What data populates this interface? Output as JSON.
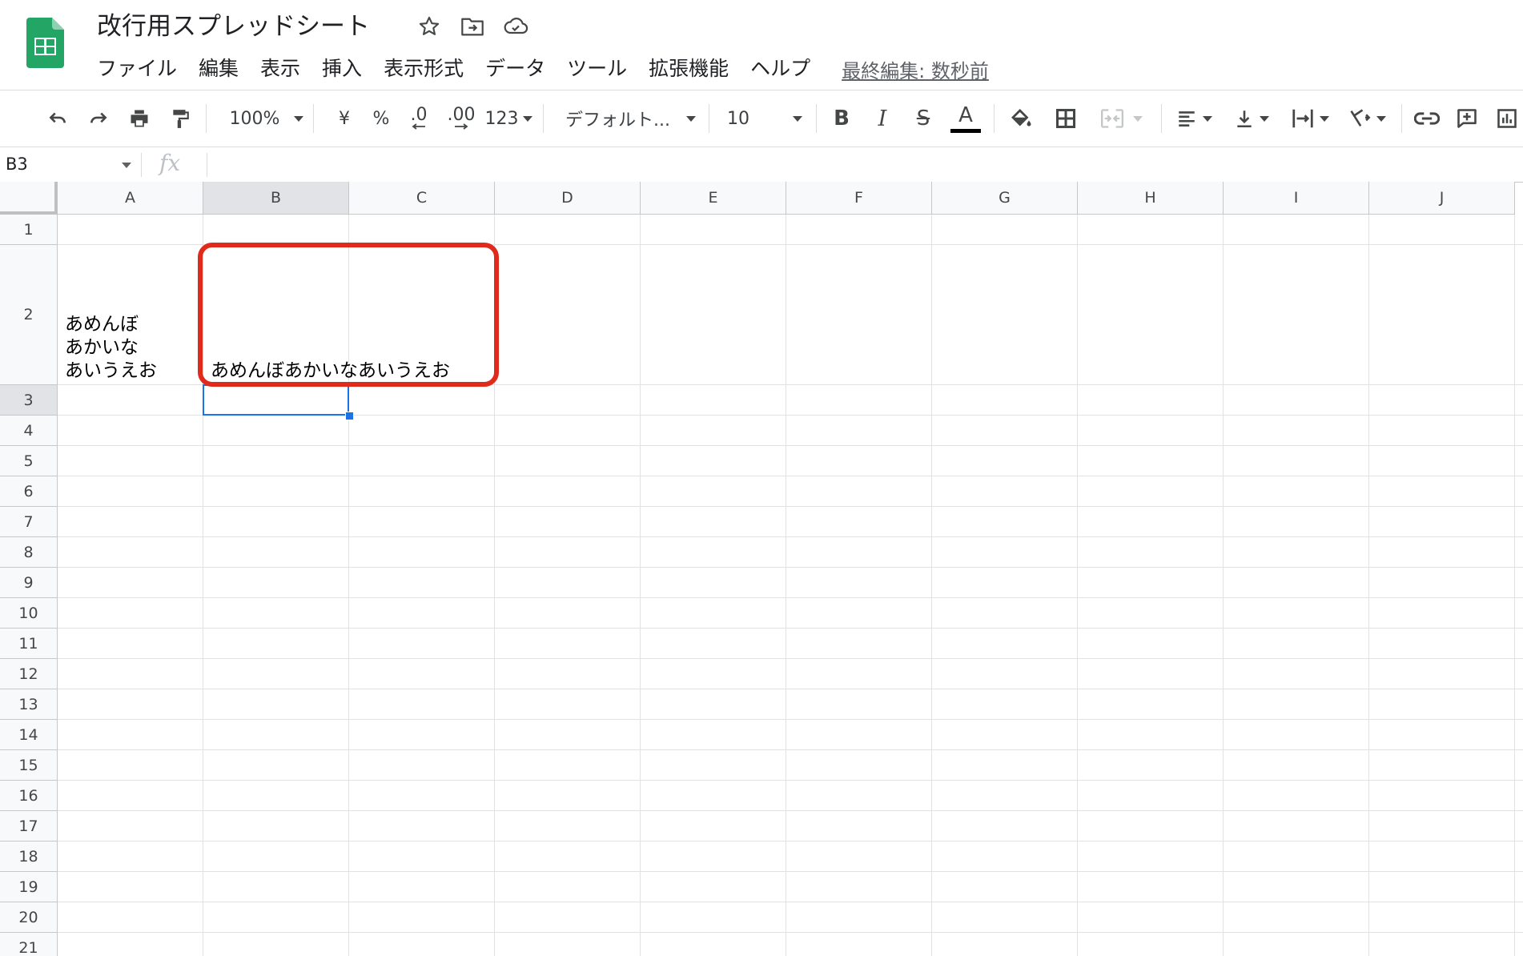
{
  "app": {
    "logo_icon": "google-sheets-logo-icon",
    "brand_color": "#23a566"
  },
  "document": {
    "title": "改行用スプレッドシート"
  },
  "title_icons": [
    "star-icon",
    "move-to-folder-icon",
    "cloud-saved-icon"
  ],
  "menu": [
    {
      "label": "ファイル"
    },
    {
      "label": "編集"
    },
    {
      "label": "表示"
    },
    {
      "label": "挿入"
    },
    {
      "label": "表示形式"
    },
    {
      "label": "データ"
    },
    {
      "label": "ツール"
    },
    {
      "label": "拡張機能"
    },
    {
      "label": "ヘルプ"
    }
  ],
  "last_edit": "最終編集: 数秒前",
  "toolbar": {
    "zoom": "100%",
    "currency": "¥",
    "percent": "%",
    "decrease_decimal": ".0",
    "increase_decimal": ".00",
    "more_formats": "123",
    "font": "デフォルト...",
    "font_size": "10",
    "bold": "B",
    "italic": "I",
    "strike": "S",
    "text_color": "A",
    "text_color_value": "#000000"
  },
  "formula_bar": {
    "name_box": "B3",
    "fx_label": "fx",
    "formula": ""
  },
  "grid": {
    "columns": [
      "A",
      "B",
      "C",
      "D",
      "E",
      "F",
      "G",
      "H",
      "I",
      "J"
    ],
    "rows": [
      "1",
      "2",
      "3",
      "4",
      "5",
      "6",
      "7",
      "8",
      "9",
      "10",
      "11",
      "12",
      "13",
      "14",
      "15",
      "16",
      "17",
      "18",
      "19",
      "20",
      "21"
    ],
    "active_column": "B",
    "active_row": "3",
    "selected_cell": "B3",
    "cells": {
      "A2": "あめんぼ\nあかいな\nあいうえお",
      "B2": "あめんぼあかいなあいうえお"
    },
    "selection_color": "#1a73e8",
    "annotation_color": "#e02a1b"
  }
}
